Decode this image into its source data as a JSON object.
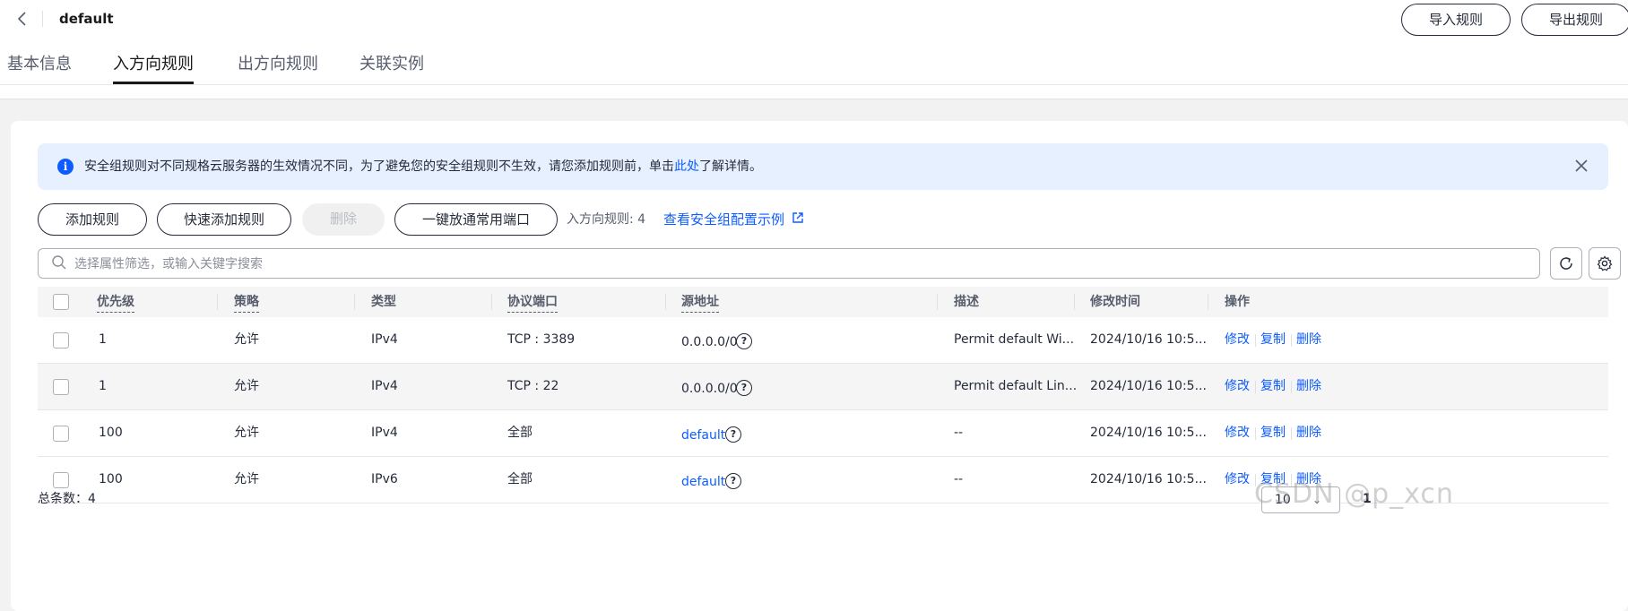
{
  "header": {
    "back_icon": "chevron-left-icon",
    "title": "default",
    "import_button": "导入规则",
    "export_button": "导出规则"
  },
  "tabs": [
    {
      "label": "基本信息",
      "active": false
    },
    {
      "label": "入方向规则",
      "active": true
    },
    {
      "label": "出方向规则",
      "active": false
    },
    {
      "label": "关联实例",
      "active": false
    }
  ],
  "notice": {
    "icon": "info-icon",
    "text_before": "安全组规则对不同规格云服务器的生效情况不同，为了避免您的安全组规则不生效，请您添加规则前，单击",
    "link": "此处",
    "text_after": "了解详情。",
    "close_icon": "close-icon"
  },
  "toolbar": {
    "add_rule": "添加规则",
    "quick_add_rule": "快速添加规则",
    "delete": "删除",
    "open_common_ports": "一键放通常用端口",
    "rule_count": "入方向规则: 4",
    "example_link": "查看安全组配置示例"
  },
  "search": {
    "placeholder": "选择属性筛选，或输入关键字搜索"
  },
  "table": {
    "columns": [
      "优先级",
      "策略",
      "类型",
      "协议端口",
      "源地址",
      "描述",
      "修改时间",
      "操作"
    ],
    "rows": [
      {
        "priority": "1",
        "policy": "允许",
        "type": "IPv4",
        "port": "TCP : 3389",
        "source": "0.0.0.0/0",
        "source_is_link": false,
        "description": "Permit default Wi...",
        "modified": "2024/10/16 10:5..."
      },
      {
        "priority": "1",
        "policy": "允许",
        "type": "IPv4",
        "port": "TCP : 22",
        "source": "0.0.0.0/0",
        "source_is_link": false,
        "description": "Permit default Lin...",
        "modified": "2024/10/16 10:5..."
      },
      {
        "priority": "100",
        "policy": "允许",
        "type": "IPv4",
        "port": "全部",
        "source": "default",
        "source_is_link": true,
        "description": "--",
        "modified": "2024/10/16 10:5..."
      },
      {
        "priority": "100",
        "policy": "允许",
        "type": "IPv6",
        "port": "全部",
        "source": "default",
        "source_is_link": true,
        "description": "--",
        "modified": "2024/10/16 10:5..."
      }
    ],
    "actions": {
      "edit": "修改",
      "copy": "复制",
      "delete": "删除"
    }
  },
  "footer": {
    "total": "总条数：4",
    "page_size": "10",
    "current_page": "1"
  },
  "watermark": "CSDN @p_xcn",
  "colors": {
    "accent": "#0d5cff",
    "notice_bg": "#e6f0ff",
    "text": "#252b3a"
  }
}
